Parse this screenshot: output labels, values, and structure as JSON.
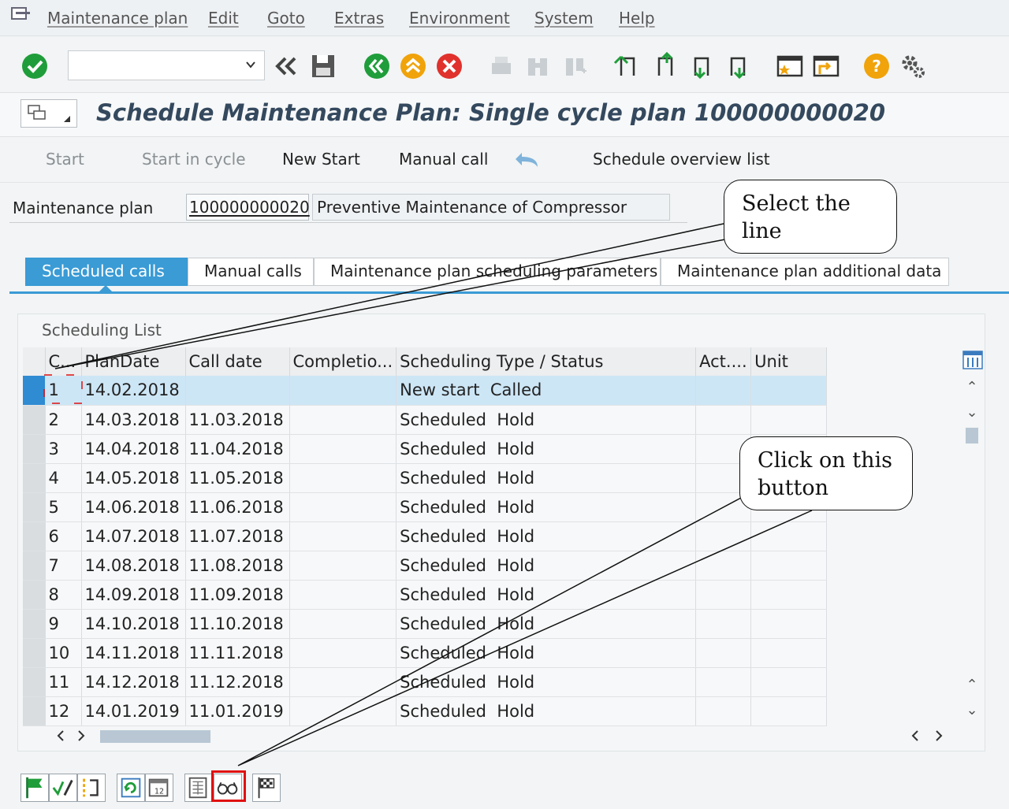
{
  "menu": [
    "Maintenance plan",
    "Edit",
    "Goto",
    "Extras",
    "Environment",
    "System",
    "Help"
  ],
  "title": "Schedule Maintenance Plan: Single cycle plan 100000000020",
  "app_toolbar": {
    "start": "Start",
    "start_in_cycle": "Start in cycle",
    "new_start": "New Start",
    "manual_call": "Manual call",
    "schedule_overview": "Schedule overview list"
  },
  "header": {
    "label": "Maintenance plan",
    "plan_number": "100000000020",
    "plan_description": "Preventive Maintenance of Compressor"
  },
  "tabs": [
    "Scheduled calls",
    "Manual calls",
    "Maintenance plan scheduling parameters",
    "Maintenance plan additional data"
  ],
  "table": {
    "title": "Scheduling List",
    "columns": [
      "C...",
      "PlanDate",
      "Call date",
      "Completio...",
      "Scheduling Type / Status",
      "Act....",
      "Unit"
    ],
    "rows": [
      [
        "1",
        "14.02.2018",
        "",
        "",
        "New start  Called",
        "",
        ""
      ],
      [
        "2",
        "14.03.2018",
        "11.03.2018",
        "",
        "Scheduled  Hold",
        "",
        ""
      ],
      [
        "3",
        "14.04.2018",
        "11.04.2018",
        "",
        "Scheduled  Hold",
        "",
        ""
      ],
      [
        "4",
        "14.05.2018",
        "11.05.2018",
        "",
        "Scheduled  Hold",
        "",
        ""
      ],
      [
        "5",
        "14.06.2018",
        "11.06.2018",
        "",
        "Scheduled  Hold",
        "",
        ""
      ],
      [
        "6",
        "14.07.2018",
        "11.07.2018",
        "",
        "Scheduled  Hold",
        "",
        ""
      ],
      [
        "7",
        "14.08.2018",
        "11.08.2018",
        "",
        "Scheduled  Hold",
        "",
        ""
      ],
      [
        "8",
        "14.09.2018",
        "11.09.2018",
        "",
        "Scheduled  Hold",
        "",
        ""
      ],
      [
        "9",
        "14.10.2018",
        "11.10.2018",
        "",
        "Scheduled  Hold",
        "",
        ""
      ],
      [
        "10",
        "14.11.2018",
        "11.11.2018",
        "",
        "Scheduled  Hold",
        "",
        ""
      ],
      [
        "11",
        "14.12.2018",
        "11.12.2018",
        "",
        "Scheduled  Hold",
        "",
        ""
      ],
      [
        "12",
        "14.01.2019",
        "11.01.2019",
        "",
        "Scheduled  Hold",
        "",
        ""
      ]
    ]
  },
  "annotations": {
    "select_line": "Select the line",
    "click_button": "Click on this button"
  },
  "colors": {
    "accent": "#3a9bd5",
    "title": "#34495e",
    "highlight": "#e01010",
    "ok_green": "#1f9d3a",
    "cancel_red": "#e0312c",
    "help_orange": "#f0a30a"
  }
}
